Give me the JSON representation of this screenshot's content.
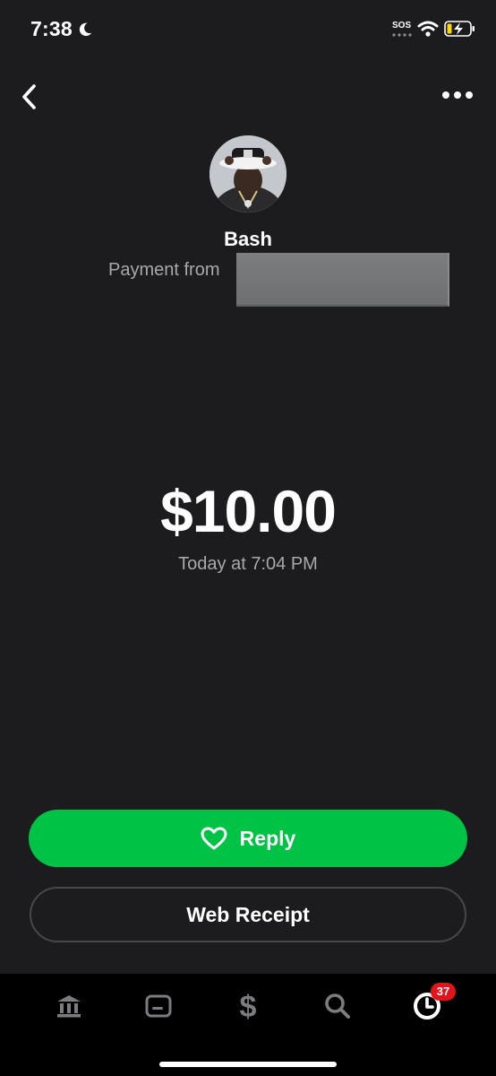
{
  "status_bar": {
    "time": "7:38",
    "sos": "SOS",
    "icons": [
      "moon-icon",
      "wifi-icon",
      "battery-charging-icon"
    ]
  },
  "nav": {
    "back_icon": "chevron-left-icon",
    "more_icon": "more-horizontal-icon"
  },
  "payment": {
    "name": "Bash",
    "subtitle": "Payment from",
    "amount": "$10.00",
    "date": "Today at 7:04 PM"
  },
  "actions": {
    "reply_label": "Reply",
    "reply_icon": "heart-icon",
    "receipt_label": "Web Receipt"
  },
  "tab_bar": {
    "items": [
      "bank-icon",
      "card-icon",
      "dollar-icon",
      "search-icon",
      "activity-clock-icon"
    ],
    "activity_badge": "37"
  },
  "colors": {
    "background": "#1c1c1e",
    "accent_green": "#00c244",
    "badge_red": "#e1141b",
    "secondary_text": "#a9a9ad"
  }
}
